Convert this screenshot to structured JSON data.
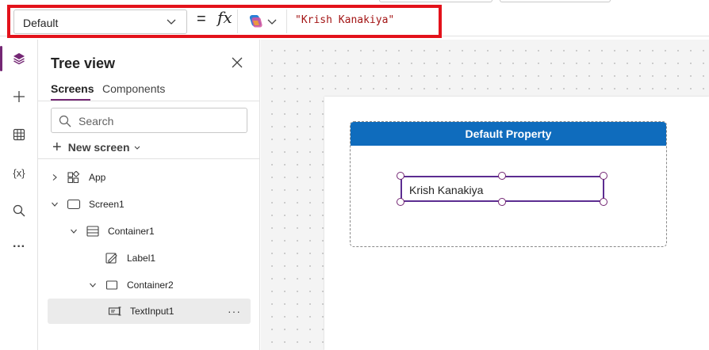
{
  "formula_bar": {
    "property": "Default",
    "equals": "=",
    "fx": "fx",
    "formula": "\"Krish Kanakiya\""
  },
  "rail": {
    "items": [
      {
        "icon": "layers-icon",
        "active": true
      },
      {
        "icon": "plus-icon"
      },
      {
        "icon": "table-icon"
      },
      {
        "icon": "variables-icon",
        "text": "{x}"
      },
      {
        "icon": "search-icon"
      },
      {
        "icon": "more-icon",
        "text": "···"
      }
    ]
  },
  "tree": {
    "title": "Tree view",
    "tabs": [
      "Screens",
      "Components"
    ],
    "search_placeholder": "Search",
    "new_screen": "New screen",
    "nodes": [
      {
        "label": "App",
        "icon": "app-icon"
      },
      {
        "label": "Screen1",
        "icon": "screen-icon"
      },
      {
        "label": "Container1",
        "icon": "vertical-container-icon"
      },
      {
        "label": "Label1",
        "icon": "label-icon"
      },
      {
        "label": "Container2",
        "icon": "container-icon"
      },
      {
        "label": "TextInput1",
        "icon": "text-input-icon",
        "selected": true,
        "more": "···"
      }
    ]
  },
  "canvas": {
    "container_header": "Default Property",
    "text_input_value": "Krish Kanakiya"
  },
  "colors": {
    "accent": "#742774",
    "header_blue": "#0f6cbd",
    "highlight_red": "#e3121b",
    "formula_string": "#a31515"
  }
}
